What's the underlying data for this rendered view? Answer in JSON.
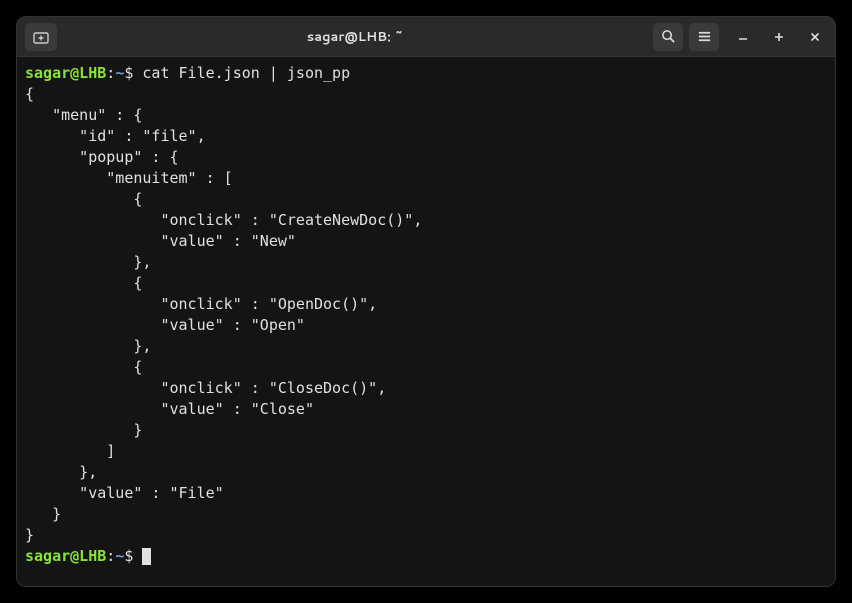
{
  "title": "sagar@LHB: ~",
  "prompt": {
    "user_host": "sagar@LHB",
    "colon": ":",
    "path": "~",
    "dollar": "$ "
  },
  "command": "cat File.json | json_pp",
  "output": "{\n   \"menu\" : {\n      \"id\" : \"file\",\n      \"popup\" : {\n         \"menuitem\" : [\n            {\n               \"onclick\" : \"CreateNewDoc()\",\n               \"value\" : \"New\"\n            },\n            {\n               \"onclick\" : \"OpenDoc()\",\n               \"value\" : \"Open\"\n            },\n            {\n               \"onclick\" : \"CloseDoc()\",\n               \"value\" : \"Close\"\n            }\n         ]\n      },\n      \"value\" : \"File\"\n   }\n}"
}
